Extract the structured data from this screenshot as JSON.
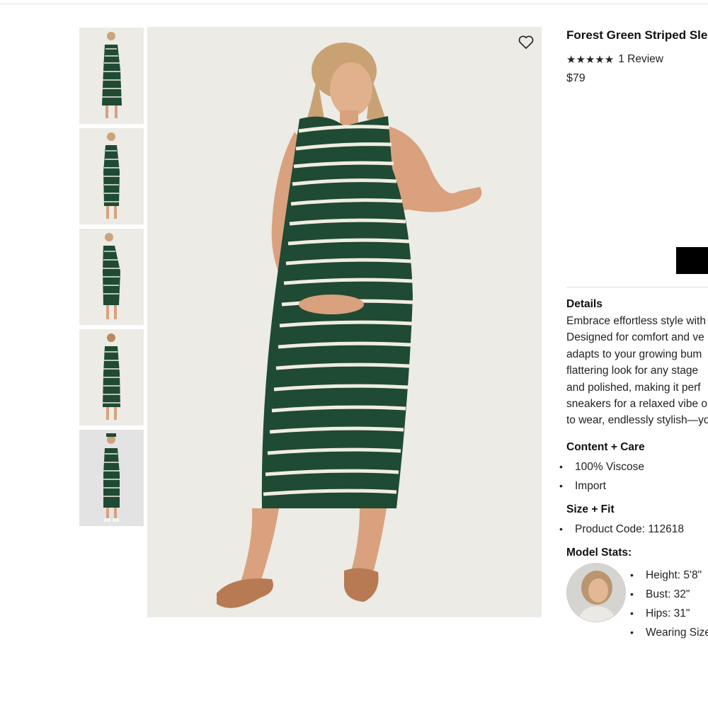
{
  "product": {
    "title": "Forest Green Striped Sle",
    "stars": "★★★★★",
    "review_label": "1 Review",
    "price": "$79"
  },
  "gallery": {
    "thumbnail_count": 5,
    "main_alt": "Forest Green Striped Sleeveless Maternity Midi Dress"
  },
  "details": {
    "heading": "Details",
    "lines": [
      "Embrace effortless style with",
      "Designed for comfort and ve",
      "adapts to your growing bum",
      "flattering look for any stage",
      "and polished, making it perf",
      "sneakers for a relaxed vibe o",
      "to wear, endlessly stylish—yo"
    ]
  },
  "content_care": {
    "heading": "Content + Care",
    "items": [
      "100% Viscose",
      "Import"
    ]
  },
  "size_fit": {
    "heading": "Size + Fit",
    "items": [
      "Product Code: 112618"
    ]
  },
  "model_stats": {
    "heading": "Model Stats:",
    "items": [
      "Height: 5'8\"",
      "Bust: 32\"",
      "Hips: 31\"",
      "Wearing Size"
    ]
  },
  "colors": {
    "dress_green": "#1f4a33",
    "stripe": "#f1ede0",
    "background": "#ecebe5",
    "skin": "#d9a17e"
  }
}
